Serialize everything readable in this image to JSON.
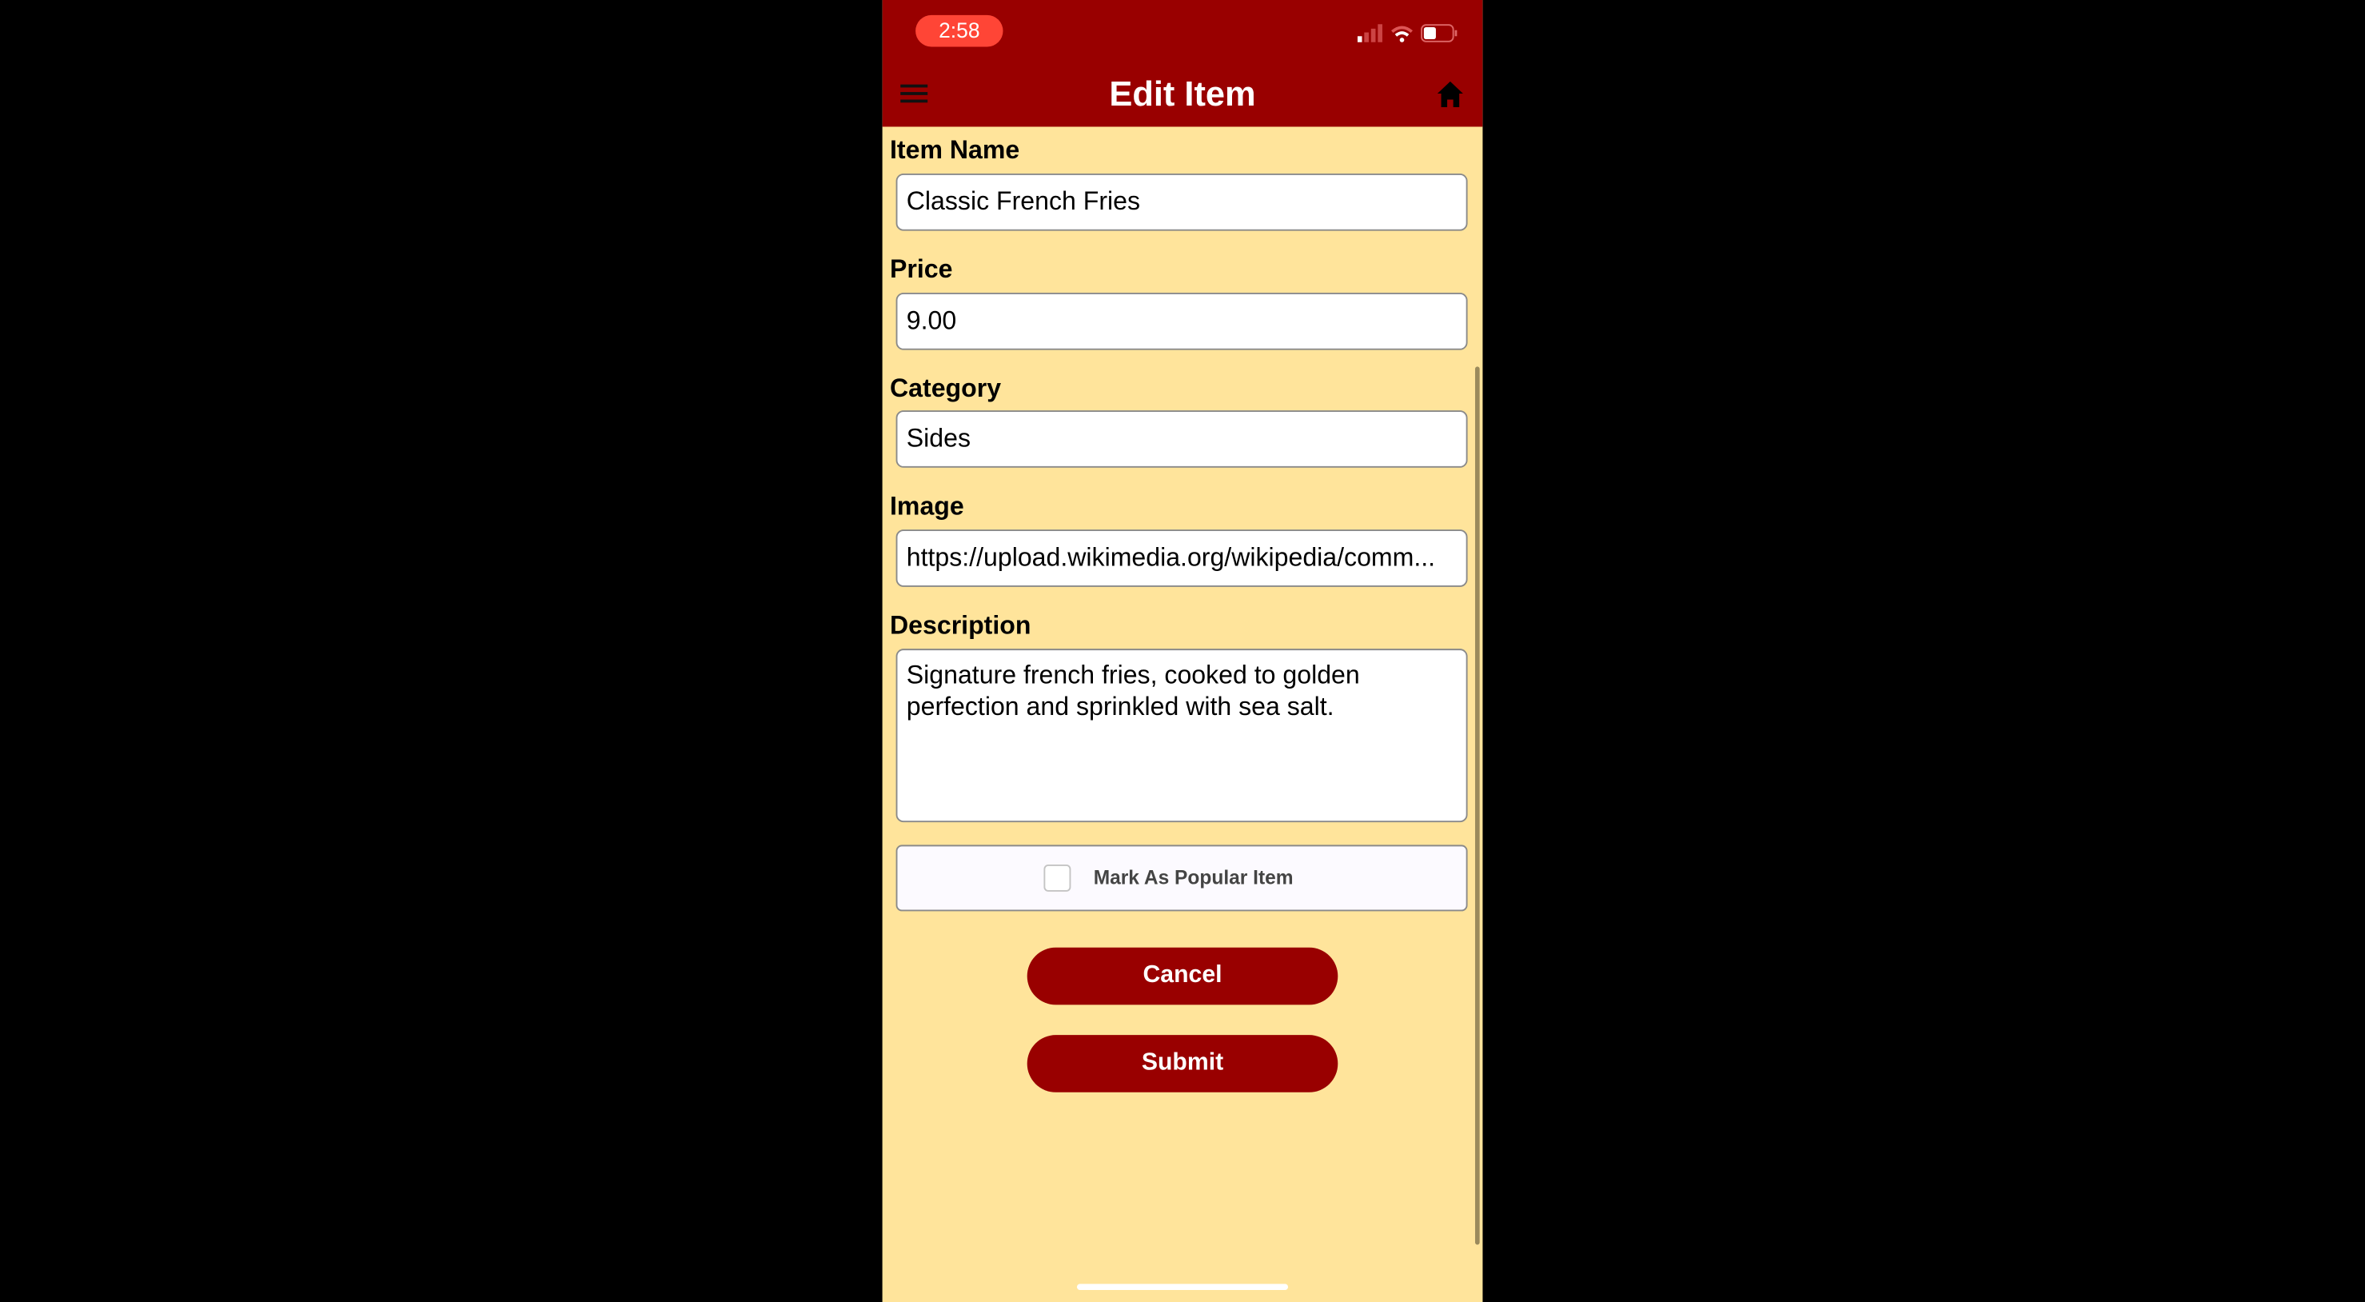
{
  "status_bar": {
    "time": "2:58"
  },
  "header": {
    "title": "Edit Item"
  },
  "form": {
    "item_name": {
      "label": "Item Name",
      "value": "Classic French Fries"
    },
    "price": {
      "label": "Price",
      "value": "9.00"
    },
    "category": {
      "label": "Category",
      "value": "Sides"
    },
    "image": {
      "label": "Image",
      "value": "https://upload.wikimedia.org/wikipedia/comm..."
    },
    "description": {
      "label": "Description",
      "value": "Signature french fries, cooked to golden perfection and sprinkled with sea salt."
    },
    "popular": {
      "label": "Mark As Popular Item",
      "checked": false
    }
  },
  "buttons": {
    "cancel": "Cancel",
    "submit": "Submit"
  },
  "colors": {
    "primary": "#990000",
    "background": "#FFE49B",
    "time_pill": "#FF4536"
  }
}
